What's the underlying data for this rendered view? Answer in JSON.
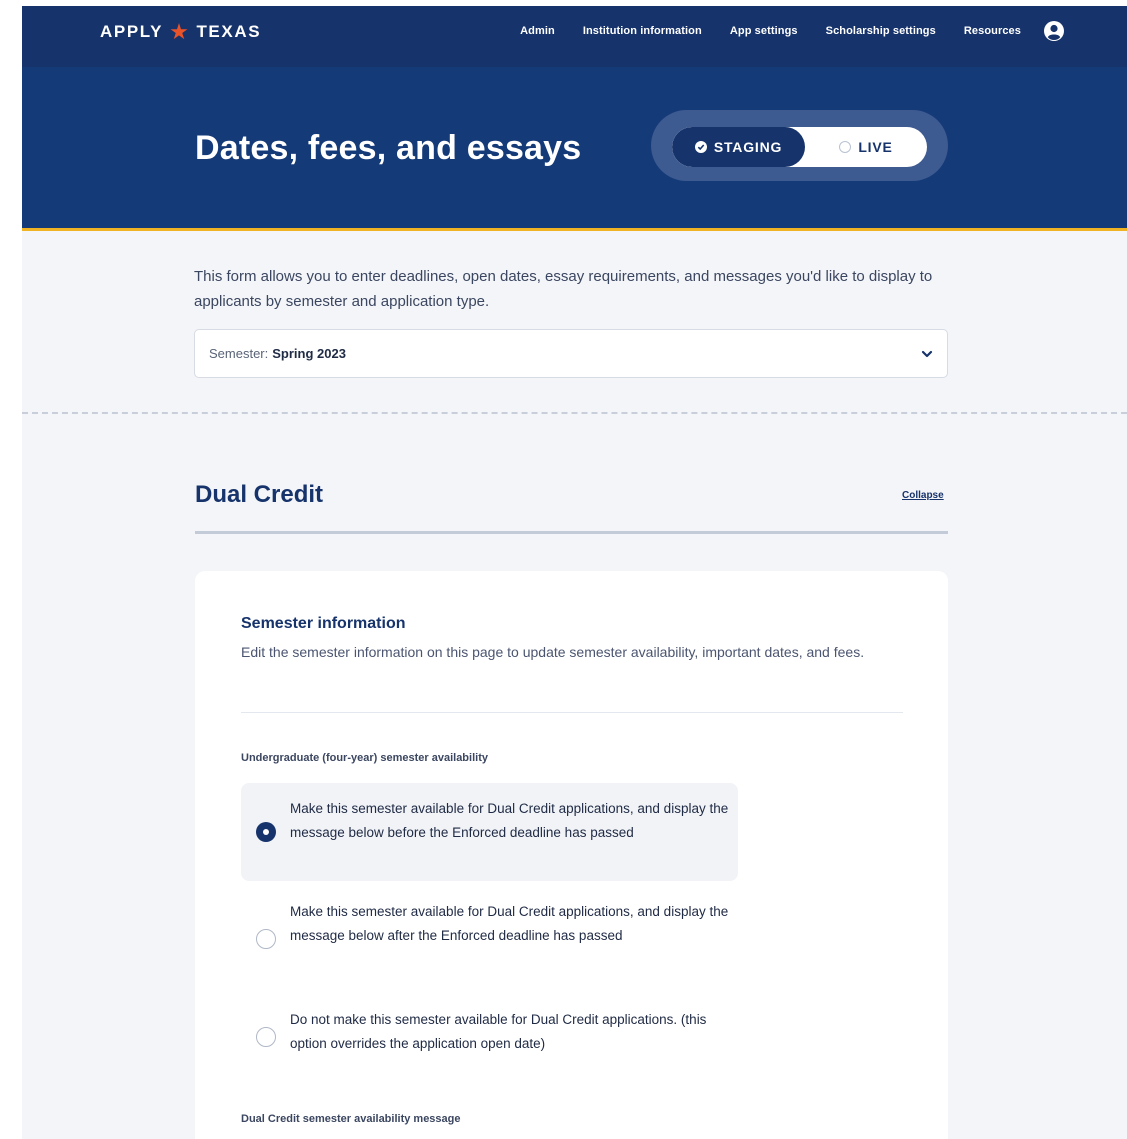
{
  "nav": {
    "logo_left": "APPLY",
    "logo_right": "TEXAS",
    "links": [
      "Admin",
      "Institution information",
      "App settings",
      "Scholarship settings",
      "Resources"
    ]
  },
  "header": {
    "title": "Dates, fees, and essays",
    "env_staging": "STAGING",
    "env_live": "LIVE"
  },
  "intro": {
    "text": "This form allows you to enter deadlines, open dates, essay requirements, and messages you'd like to display to applicants by semester and application type.",
    "semester_label": "Semester:",
    "semester_value": "Spring 2023"
  },
  "section": {
    "title": "Dual Credit",
    "collapse": "Collapse"
  },
  "card": {
    "title": "Semester information",
    "description": "Edit the semester information on this page to update semester availability, important dates, and fees.",
    "availability_label": "Undergraduate (four-year) semester availability",
    "options": [
      "Make this semester available for Dual Credit applications, and display the message below before the Enforced deadline has passed",
      "Make this semester available for Dual Credit applications, and display the message below after the Enforced deadline has passed",
      "Do not make this semester available for Dual Credit applications. (this option overrides the application open date)"
    ],
    "selected_option": 0,
    "message_label": "Dual Credit semester availability message"
  },
  "colors": {
    "navy": "#16336b",
    "hero": "#143a78",
    "accent_gold": "#f0b323",
    "star": "#e8532a"
  }
}
